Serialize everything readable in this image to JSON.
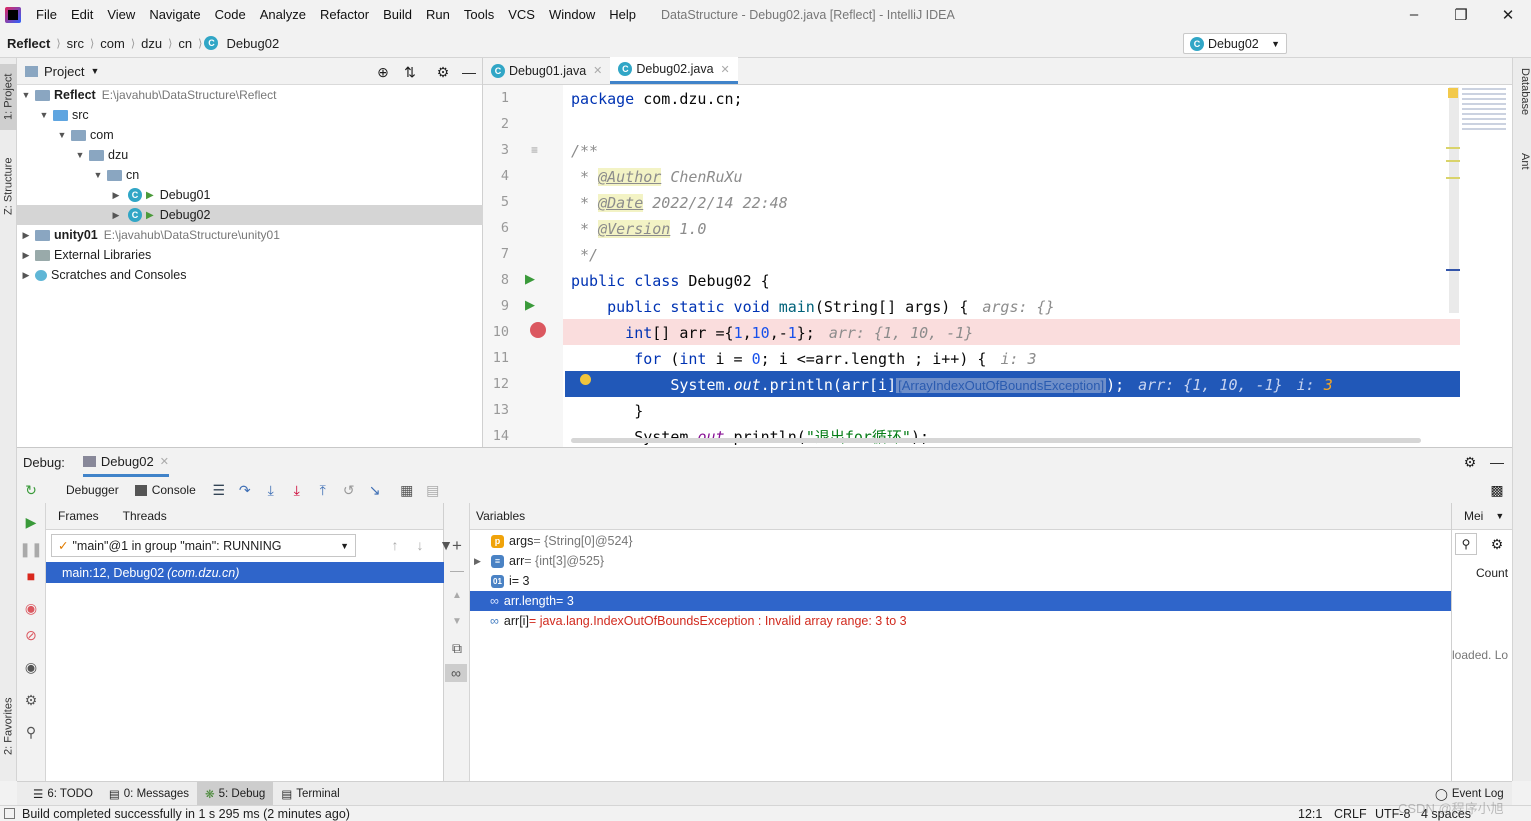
{
  "menu": {
    "items": [
      "File",
      "Edit",
      "View",
      "Navigate",
      "Code",
      "Analyze",
      "Refactor",
      "Build",
      "Run",
      "Tools",
      "VCS",
      "Window",
      "Help"
    ],
    "window_title": "DataStructure - Debug02.java [Reflect] - IntelliJ IDEA"
  },
  "nav": {
    "crumbs": [
      "Reflect",
      "src",
      "com",
      "dzu",
      "cn",
      "Debug02"
    ],
    "run_config": "Debug02"
  },
  "left_strip": {
    "project": "1: Project",
    "structure": "Z: Structure",
    "favorites": "2: Favorites"
  },
  "right_strip": {
    "database": "Database",
    "ant": "Ant"
  },
  "project": {
    "header": "Project",
    "tree": [
      {
        "label": "Reflect",
        "path": "E:\\javahub\\DataStructure\\Reflect"
      },
      {
        "label": "src"
      },
      {
        "label": "com"
      },
      {
        "label": "dzu"
      },
      {
        "label": "cn"
      },
      {
        "label": "Debug01"
      },
      {
        "label": "Debug02"
      },
      {
        "label": "unity01",
        "path": "E:\\javahub\\DataStructure\\unity01"
      },
      {
        "label": "External Libraries"
      },
      {
        "label": "Scratches and Consoles"
      }
    ]
  },
  "editor": {
    "tabs": [
      "Debug01.java",
      "Debug02.java"
    ],
    "line_numbers": [
      "1",
      "2",
      "3",
      "4",
      "5",
      "6",
      "7",
      "8",
      "9",
      "10",
      "11",
      "12",
      "13",
      "14"
    ],
    "code": {
      "l1a": "package",
      "l1b": " com.dzu.cn;",
      "l3": "/**",
      "l4a": " * ",
      "l4b": "@Author",
      "l4c": " ChenRuXu",
      "l5a": " * ",
      "l5b": "@Date",
      "l5c": " 2022/2/14 22:48",
      "l6a": " * ",
      "l6b": "@Version",
      "l6c": " 1.0",
      "l7": " */",
      "l8a": "public class",
      "l8b": " Debug02 {",
      "l9a": "    public static void ",
      "l9b": "main",
      "l9c": "(String[] args) {",
      "l9d": "args: {}",
      "l10a": "      int",
      "l10b": "[] arr ={",
      "l10c": "1",
      "l10d": ",",
      "l10e": "10",
      "l10f": ",-",
      "l10g": "1",
      "l10h": "};",
      "l10i": "arr: {1, 10, -1}",
      "l11a": "       for ",
      "l11b": "(",
      "l11c": "int",
      " l11d": "",
      "l11e": " i = ",
      "l11f": "0",
      "l11g": "; i <=arr.length ; i++) {",
      "l11h": "i: 3",
      "l12a": "           System.",
      "l12b": "out",
      "l12c": ".println(arr[i]",
      "l12d": "[ArrayIndexOutOfBoundsException]",
      "l12e": ");",
      "l12f": "arr: {1, 10, -1}",
      "l12g": "i: ",
      "l12h": "3",
      "l13": "       }",
      "l14a": "       System.",
      "l14b": "out",
      "l14c": ".println(",
      "l14d": "\"退出for循环\"",
      "l14e": ");"
    }
  },
  "debug": {
    "label": "Debug:",
    "session": "Debug02",
    "toolbar": {
      "debugger": "Debugger",
      "console": "Console"
    },
    "frames_tabs": [
      "Frames",
      "Threads"
    ],
    "thread": "\"main\"@1 in group \"main\": RUNNING",
    "frame": "main:12, Debug02 ",
    "frame_pkg": "(com.dzu.cn)",
    "variables_header": "Variables",
    "vars": [
      {
        "name": "args",
        "value": " = {String[0]@524}"
      },
      {
        "name": "arr",
        "value": " = {int[3]@525}"
      },
      {
        "name": "i",
        "value": " = 3"
      },
      {
        "name": "arr.length",
        "value": " = 3"
      },
      {
        "name": "arr[i]",
        "value": " = java.lang.IndexOutOfBoundsException : Invalid array range: 3 to 3"
      }
    ],
    "memory": {
      "tab": "Mei",
      "count": "Count",
      "loaded": "loaded. Lo"
    }
  },
  "bottom_tabs": [
    "6: TODO",
    "0: Messages",
    "5: Debug",
    "Terminal",
    "Event Log"
  ],
  "status": {
    "message": "Build completed successfully in 1 s 295 ms (2 minutes ago)",
    "position": "12:1",
    "line_sep": "CRLF",
    "encoding": "UTF-8",
    "indent": "4 spaces",
    "watermark": "CSDN @程序小旭"
  },
  "colors": {
    "accent": "#2f65ca",
    "exec_line": "#2158b8",
    "breakpoint_line": "#fadddd",
    "keyword": "#0033b3"
  }
}
